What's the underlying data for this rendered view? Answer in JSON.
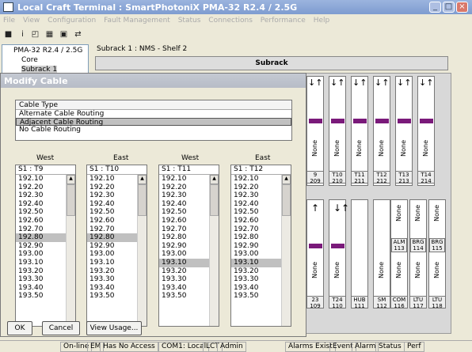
{
  "window": {
    "title": "Local Craft Terminal : SmartPhotoniX PMA-32 R2.4 / 2.5G",
    "min": "_",
    "max": "□",
    "close": "×"
  },
  "menu": [
    "File",
    "View",
    "Configuration",
    "Fault Management",
    "Status",
    "Connections",
    "Performance",
    "Help"
  ],
  "tree": {
    "root": "PMA-32 R2.4 / 2.5G",
    "core": "Core",
    "subrack": "Subrack 1"
  },
  "subrack_title": "Subrack 1 : NMS - Shelf 2",
  "subrack_button": "Subrack",
  "dialog": {
    "title": "Modify Cable",
    "cable_header": "Cable Type",
    "cable_options": [
      "Alternate Cable Routing",
      "Adjacent Cable Routing",
      "No Cable Routing"
    ],
    "selected_option": "Adjacent Cable Routing",
    "columns": [
      {
        "side": "West",
        "header": "S1 : T9",
        "values": [
          "192.10",
          "192.20",
          "192.30",
          "192.40",
          "192.50",
          "192.60",
          "192.70",
          "192.80",
          "192.90",
          "193.00",
          "193.10",
          "193.20",
          "193.30",
          "193.40",
          "193.50"
        ],
        "selected": "192.80"
      },
      {
        "side": "East",
        "header": "S1 : T10",
        "values": [
          "192.10",
          "192.20",
          "192.30",
          "192.40",
          "192.50",
          "192.60",
          "192.70",
          "192.80",
          "192.90",
          "193.00",
          "193.10",
          "193.20",
          "193.30",
          "193.40",
          "193.50"
        ],
        "selected": "192.80"
      },
      {
        "side": "West",
        "header": "S1 : T11",
        "values": [
          "192.10",
          "192.20",
          "192.30",
          "192.40",
          "192.50",
          "192.60",
          "192.70",
          "192.80",
          "192.90",
          "193.00",
          "193.10",
          "193.20",
          "193.30",
          "193.40",
          "193.50"
        ],
        "selected": "193.10"
      },
      {
        "side": "East",
        "header": "S1 : T12",
        "values": [
          "192.10",
          "192.20",
          "192.30",
          "192.40",
          "192.50",
          "192.60",
          "192.70",
          "192.80",
          "192.90",
          "193.00",
          "193.10",
          "193.20",
          "193.30",
          "193.40",
          "193.50"
        ],
        "selected": "193.10"
      }
    ],
    "ok": "OK",
    "cancel": "Cancel",
    "view_usage": "View Usage..."
  },
  "top_cards": [
    {
      "label": "None",
      "foot1": "9",
      "foot2": "209"
    },
    {
      "label": "None",
      "foot1": "T10",
      "foot2": "210"
    },
    {
      "label": "None",
      "foot1": "T11",
      "foot2": "211"
    },
    {
      "label": "None",
      "foot1": "T12",
      "foot2": "212"
    },
    {
      "label": "None",
      "foot1": "T13",
      "foot2": "213"
    },
    {
      "label": "None",
      "foot1": "T14",
      "foot2": "214"
    }
  ],
  "bottom_cards": [
    {
      "label": "None",
      "foot1": "23",
      "foot2": "109"
    },
    {
      "label": "None",
      "foot1": "T24",
      "foot2": "110"
    },
    {
      "label": "",
      "foot1": "HUB",
      "foot2": "111"
    },
    {
      "label": "None",
      "foot1": "SM",
      "foot2": "112"
    },
    {
      "label": "None",
      "foot1": "COM",
      "foot2": "116",
      "top": "None",
      "sub": "ALM",
      "subn": "113"
    },
    {
      "label": "None",
      "foot1": "LTU",
      "foot2": "117",
      "top": "None",
      "sub": "BRG",
      "subn": "114"
    },
    {
      "label": "None",
      "foot1": "LTU",
      "foot2": "118",
      "top": "None",
      "sub": "BRG",
      "subn": "115"
    }
  ],
  "status": [
    "On-line",
    "EM",
    "Has No Access",
    "COM1: Local",
    "LCT",
    "Admin",
    "Alarms Exist",
    "Event",
    "Alarm",
    "Status",
    "Perf"
  ]
}
